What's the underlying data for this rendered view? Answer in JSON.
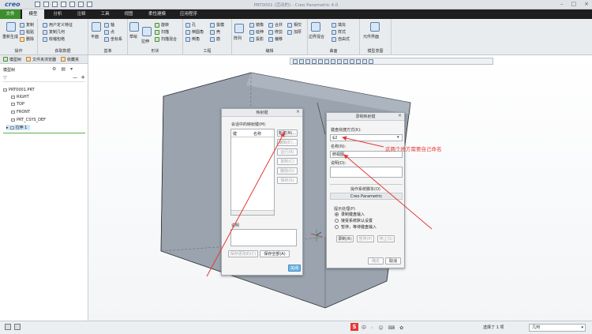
{
  "app": {
    "logo": "creo",
    "window_title": "PRT0001 (活动的) - Creo Parametric 4.0"
  },
  "tabs": [
    "文件",
    "模型",
    "分析",
    "注释",
    "工具",
    "视图",
    "柔性建模",
    "应用程序"
  ],
  "ribbon": {
    "groups": [
      {
        "name": "操作",
        "items": [
          "重新生成",
          "复制",
          "粘贴",
          "删除"
        ]
      },
      {
        "name": "获取数据",
        "items": [
          "用户定义特征",
          "复制几何",
          "收缩包络"
        ]
      },
      {
        "name": "基准",
        "items": [
          "平面",
          "轴",
          "点",
          "坐标系"
        ]
      },
      {
        "name": "形状",
        "items": [
          "草绘",
          "旋转",
          "扫描",
          "拉伸",
          "扫描混合"
        ]
      },
      {
        "name": "工程",
        "items": [
          "孔",
          "倒圆角",
          "壳",
          "拔模",
          "倒角",
          "筋"
        ]
      },
      {
        "name": "编辑",
        "items": [
          "阵列",
          "镜像",
          "延伸",
          "投影",
          "修剪",
          "偏移",
          "加厚",
          "合并",
          "相交",
          "实体化"
        ]
      },
      {
        "name": "曲面",
        "items": [
          "填充",
          "样式",
          "边界混合",
          "自由式"
        ]
      },
      {
        "name": "模型意图",
        "items": [
          "元件界面"
        ]
      }
    ]
  },
  "left_panel": {
    "tabs": [
      "模型树",
      "文件夹浏览器",
      "收藏夹"
    ],
    "header": "模型树",
    "items": [
      "PRT0001.PRT",
      "RIGHT",
      "TOP",
      "FRONT",
      "PRT_CSYS_DEF",
      "拉伸 1"
    ]
  },
  "dialog_mapkeys": {
    "title": "映射键",
    "section_label": "会话中的映射键(M)",
    "col_key": "键",
    "col_name": "名称",
    "buttons": [
      "新建(N)...",
      "编辑(E)...",
      "运行(R)",
      "复制(C)",
      "删除(D)",
      "保存(S)"
    ],
    "desc_label": "说明",
    "save_changed": "保存更改的(C)",
    "save_all": "保存全部(A)",
    "close": "关闭"
  },
  "dialog_record": {
    "title": "录制映射键",
    "key_seq_label": "键盘快捷方式(K):",
    "key_seq_value": "$2",
    "name_label": "名称(N):",
    "name_value": "俯视图",
    "desc_label": "说明(D):",
    "desc_value": "",
    "env_label": "操作系统脚本(O)",
    "env_tab": "Creo Parametric",
    "prompt_label": "提示处理(P)",
    "radios": [
      "录制键盘输入",
      "接受系统默认设置",
      "暂停，等待键盘输入"
    ],
    "selected_radio": 0,
    "buttons": [
      "录制(R)",
      "暂停(P)",
      "停止(S)"
    ],
    "ok": "确定",
    "cancel": "取消"
  },
  "annotation": {
    "text": "这两个地方需要自己命名",
    "color": "#e53935"
  },
  "status": {
    "selected": "选择了 1 项",
    "filter": "几何"
  }
}
